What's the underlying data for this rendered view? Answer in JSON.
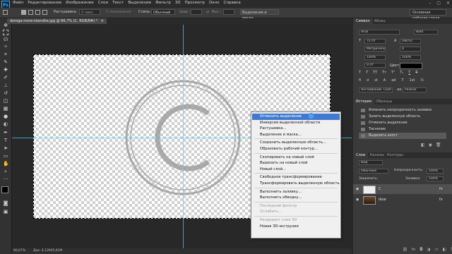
{
  "app": {
    "logo": "Ps"
  },
  "menu": [
    "Файл",
    "Редактирование",
    "Изображение",
    "Слои",
    "Текст",
    "Выделение",
    "Фильтр",
    "3D",
    "Просмотр",
    "Окно",
    "Справка"
  ],
  "window_controls": [
    "–",
    "▢",
    "✕"
  ],
  "options": {
    "feather_label": "Растушевка:",
    "feather_value": "0 пикс.",
    "smooth_label": "Сглаживание",
    "style_label": "Стиль:",
    "style_value": "Обычный",
    "width_label": "Шир.:",
    "height_label": "Выс.:",
    "refine_button": "Выделение и маска...",
    "workspace": "Основная рабочая среда"
  },
  "document": {
    "tab": "doroga-more-islandiia.jpg @ 66,7% (C, RGB/8#) *",
    "watermark": "©",
    "zoom": "66,67%",
    "doc_info": "Док: 4,12M/5,61M"
  },
  "context_menu": [
    {
      "label": "Отменить выделение",
      "state": "highlight"
    },
    {
      "label": "Инверсия выделенной области"
    },
    {
      "label": "Растушевка..."
    },
    {
      "label": "Выделение и маска..."
    },
    {
      "sep": true
    },
    {
      "label": "Сохранить выделенную область..."
    },
    {
      "label": "Образовать рабочий контур..."
    },
    {
      "sep": true
    },
    {
      "label": "Скопировать на новый слой"
    },
    {
      "label": "Вырезать на новый слой"
    },
    {
      "label": "Новый слой..."
    },
    {
      "sep": true
    },
    {
      "label": "Свободное трансформирование"
    },
    {
      "label": "Трансформировать выделенную область"
    },
    {
      "sep": true
    },
    {
      "label": "Выполнить заливку..."
    },
    {
      "label": "Выполнить обводку..."
    },
    {
      "sep": true
    },
    {
      "label": "Последний фильтр",
      "state": "disabled"
    },
    {
      "label": "Ослабить...",
      "state": "disabled"
    },
    {
      "sep": true
    },
    {
      "label": "Рендеринг слоя 3D",
      "state": "disabled"
    },
    {
      "label": "Новая 3D-экструзия"
    }
  ],
  "character_panel": {
    "tabs": [
      "Символ",
      "Абзац"
    ],
    "font": "Arial",
    "style": "Bold",
    "size": "72 пт",
    "leading": "(Авто)",
    "kerning": "Метрические",
    "tracking": "0",
    "scale_v": "100%",
    "scale_h": "100%",
    "baseline": "0 пт",
    "color_label": "Цвет:",
    "language": "Английский: США",
    "aa": "Резкое",
    "aa_prefix": "aa",
    "type_buttons": [
      "T",
      "T",
      "TT",
      "Tт",
      "T¹",
      "T₁",
      "T",
      "T"
    ],
    "extra_buttons": [
      "fi",
      "ơ",
      "st",
      "A",
      "ad",
      "T",
      "1st",
      "½"
    ]
  },
  "history_panel": {
    "tabs": [
      "История",
      "Образцы"
    ],
    "items": [
      {
        "label": "Изменить непрозрачность заливки"
      },
      {
        "label": "Залить выделенную область"
      },
      {
        "label": "Отменить выделение"
      },
      {
        "label": "Тиснение"
      },
      {
        "label": "Выделить холст",
        "selected": true
      }
    ]
  },
  "layers_panel": {
    "tabs": [
      "Слои",
      "Каналы",
      "Контуры"
    ],
    "kind": "Вид",
    "blend": "Обычные",
    "opacity_label": "Непрозрачность:",
    "opacity": "100%",
    "lock_label": "Закрепить:",
    "fill_label": "Заливка:",
    "fill": "100%",
    "layers": [
      {
        "name": "C",
        "selected": true,
        "fx": "fx"
      },
      {
        "name": "doar",
        "fx": "fx"
      }
    ]
  }
}
